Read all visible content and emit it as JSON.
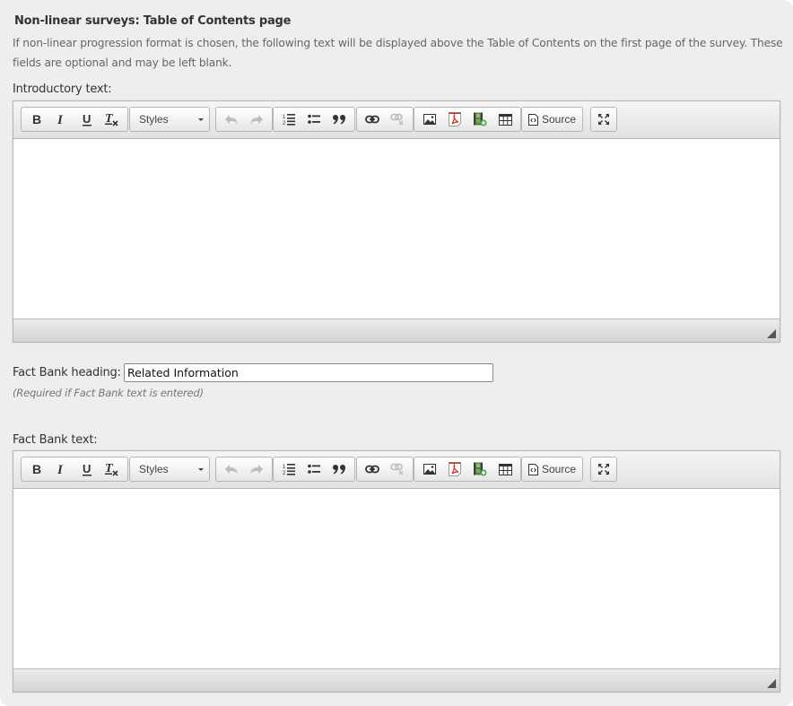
{
  "section": {
    "title": "Non-linear surveys: Table of Contents page",
    "description": "If non-linear progression format is chosen, the following text will be displayed above the Table of Contents on the first page of the survey. These fields are optional and may be left blank."
  },
  "intro": {
    "label": "Introductory text:",
    "content": ""
  },
  "fact_bank_heading": {
    "label": "Fact Bank heading:",
    "value": "Related Information",
    "hint": "(Required if Fact Bank text is entered)"
  },
  "fact_bank_text": {
    "label": "Fact Bank text:",
    "content": ""
  },
  "toolbar": {
    "styles_label": "Styles",
    "source_label": "Source",
    "buttons": {
      "bold": "bold-icon",
      "italic": "italic-icon",
      "underline": "underline-icon",
      "remove_format": "remove-format-icon",
      "undo": "undo-icon",
      "redo": "redo-icon",
      "numbered_list": "numbered-list-icon",
      "bulleted_list": "bulleted-list-icon",
      "blockquote": "blockquote-icon",
      "link": "link-icon",
      "unlink": "unlink-icon",
      "image": "image-icon",
      "pdf": "pdf-icon",
      "video": "video-icon",
      "table": "table-icon",
      "source": "source-icon",
      "maximize": "maximize-icon"
    }
  }
}
